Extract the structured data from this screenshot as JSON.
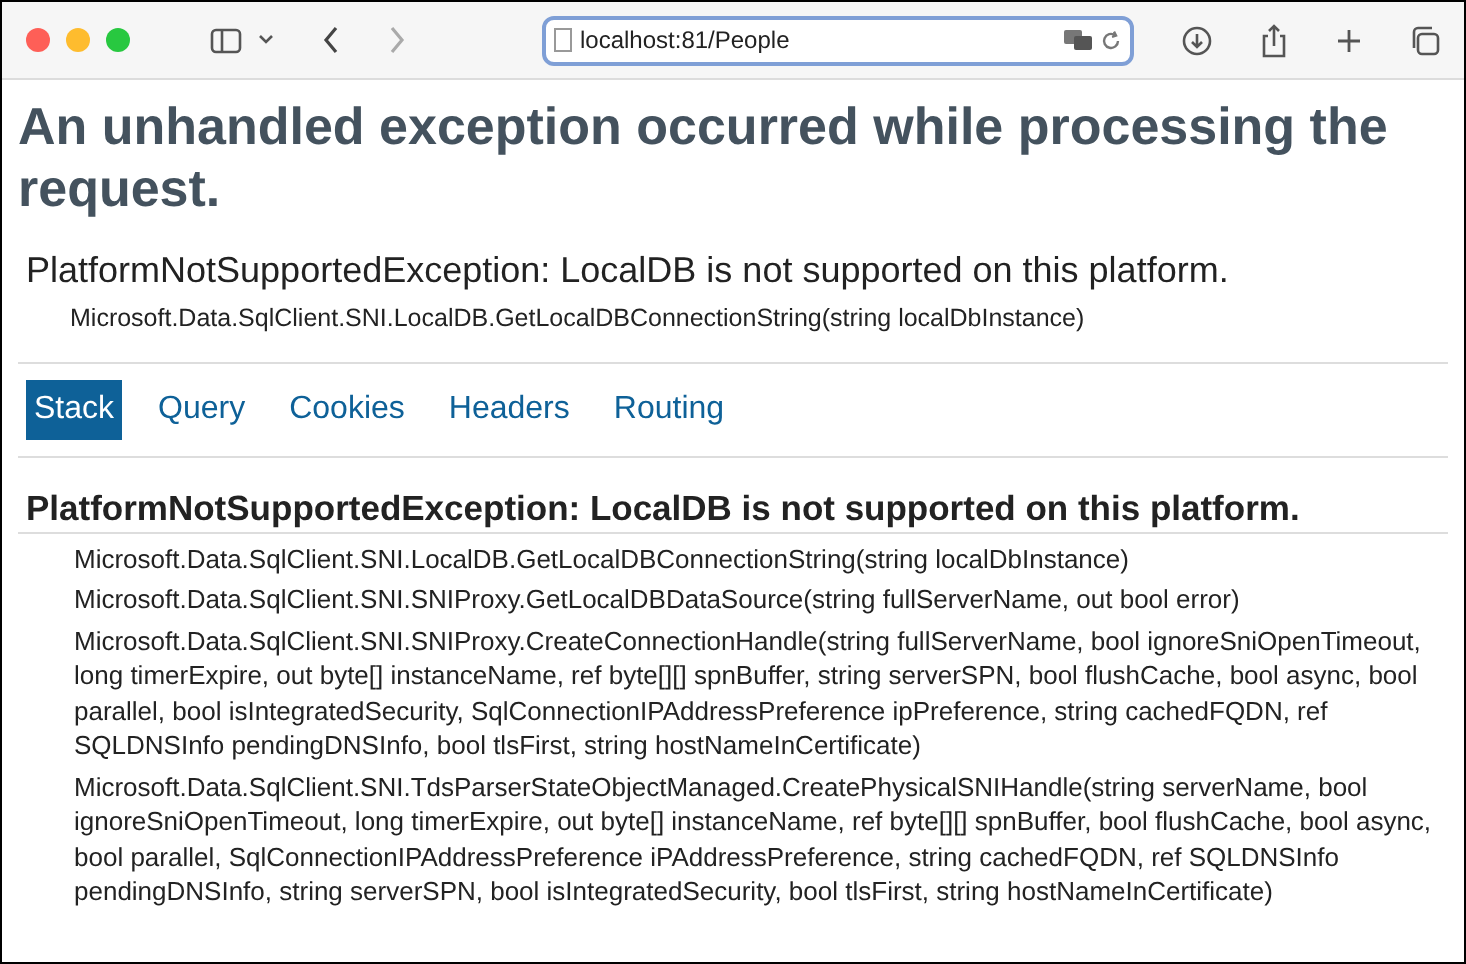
{
  "browser": {
    "address": "localhost:81/People"
  },
  "title": "An unhandled exception occurred while processing the request.",
  "exception": {
    "message": "PlatformNotSupportedException: LocalDB is not supported on this platform.",
    "location": "Microsoft.Data.SqlClient.SNI.LocalDB.GetLocalDBConnectionString(string localDbInstance)"
  },
  "tabs": [
    {
      "label": "Stack",
      "selected": true
    },
    {
      "label": "Query",
      "selected": false
    },
    {
      "label": "Cookies",
      "selected": false
    },
    {
      "label": "Headers",
      "selected": false
    },
    {
      "label": "Routing",
      "selected": false
    }
  ],
  "stack": {
    "heading": "PlatformNotSupportedException: LocalDB is not supported on this platform.",
    "frames": [
      "Microsoft.Data.SqlClient.SNI.LocalDB.GetLocalDBConnectionString(string localDbInstance)",
      "Microsoft.Data.SqlClient.SNI.SNIProxy.GetLocalDBDataSource(string fullServerName, out bool error)",
      "Microsoft.Data.SqlClient.SNI.SNIProxy.CreateConnectionHandle(string fullServerName, bool ignoreSniOpenTimeout, long timerExpire, out byte[] instanceName, ref byte[][] spnBuffer, string serverSPN, bool flushCache, bool async, bool parallel, bool isIntegratedSecurity, SqlConnectionIPAddressPreference ipPreference, string cachedFQDN, ref SQLDNSInfo pendingDNSInfo, bool tlsFirst, string hostNameInCertificate)",
      "Microsoft.Data.SqlClient.SNI.TdsParserStateObjectManaged.CreatePhysicalSNIHandle(string serverName, bool ignoreSniOpenTimeout, long timerExpire, out byte[] instanceName, ref byte[][] spnBuffer, bool flushCache, bool async, bool parallel, SqlConnectionIPAddressPreference iPAddressPreference, string cachedFQDN, ref SQLDNSInfo pendingDNSInfo, string serverSPN, bool isIntegratedSecurity, bool tlsFirst, string hostNameInCertificate)"
    ]
  }
}
